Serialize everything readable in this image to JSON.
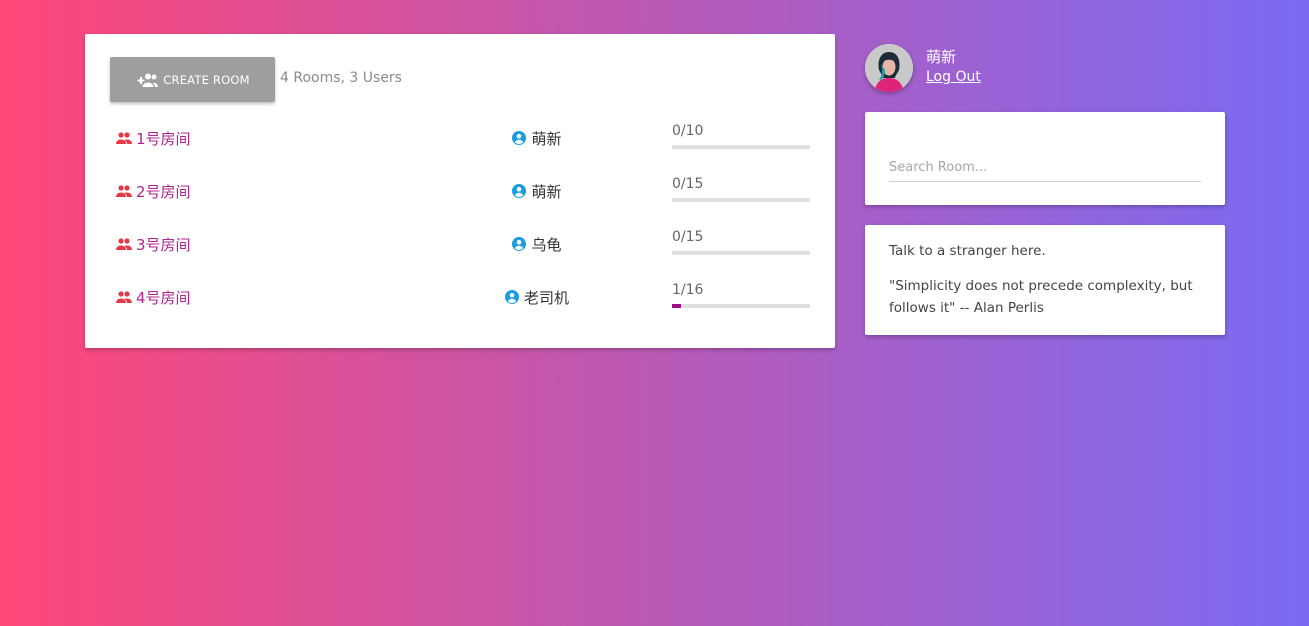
{
  "rooms_panel": {
    "create_button_label": "CREATE ROOM",
    "summary": "4 Rooms, 3 Users",
    "rooms": [
      {
        "name": "1号房间",
        "owner": "萌新",
        "capacity": "0/10",
        "occupancy": 0
      },
      {
        "name": "2号房间",
        "owner": "萌新",
        "capacity": "0/15",
        "occupancy": 0
      },
      {
        "name": "3号房间",
        "owner": "乌龟",
        "capacity": "0/15",
        "occupancy": 0
      },
      {
        "name": "4号房间",
        "owner": "老司机",
        "capacity": "1/16",
        "occupancy": 0.0625
      }
    ]
  },
  "profile": {
    "username": "萌新",
    "logout_label": "Log Out"
  },
  "search": {
    "placeholder": "Search Room..."
  },
  "info": {
    "line1": "Talk to a stranger here.",
    "quote": "\"Simplicity does not precede complexity, but follows it\" -- Alan Perlis"
  },
  "colors": {
    "room_link": "#b0258f",
    "room_icon": "#e53946",
    "owner_icon": "#1a9de0",
    "progress_fill": "#9c0f86",
    "button_bg": "#9e9e9e"
  },
  "icons": {
    "create_button": "group-add-icon",
    "room": "group-icon",
    "owner": "account-circle-icon"
  }
}
